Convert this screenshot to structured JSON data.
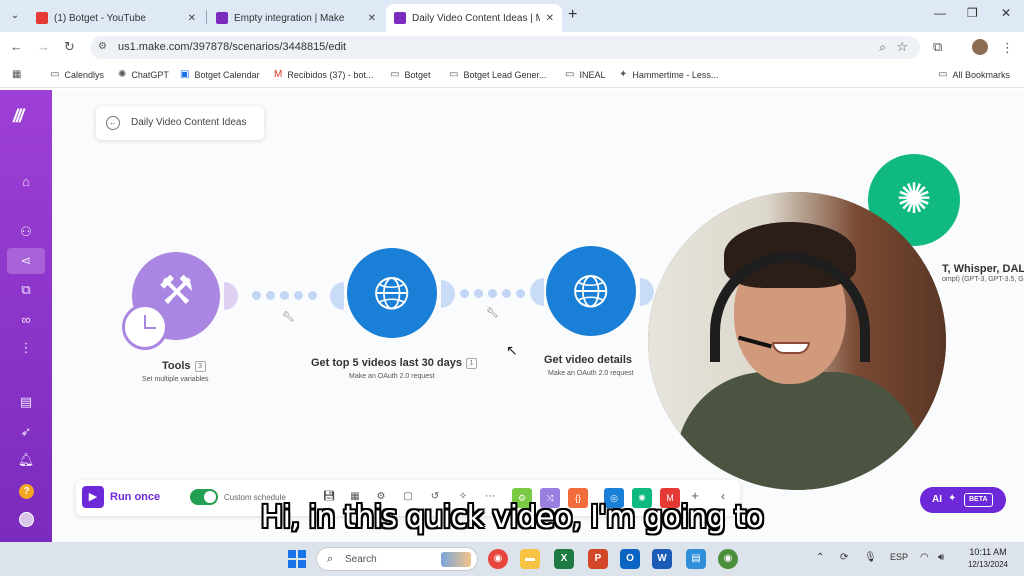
{
  "browser": {
    "tabs": [
      {
        "title": "(1) Botget - YouTube",
        "favicon_color": "#e53935"
      },
      {
        "title": "Empty integration | Make",
        "favicon_color": "#7b2cbf"
      },
      {
        "title": "Daily Video Content Ideas | Ma",
        "favicon_color": "#7b2cbf"
      }
    ],
    "new_tab": "+",
    "url": "us1.make.com/397878/scenarios/3448815/edit",
    "bookmarks": [
      {
        "label": "Calendlys",
        "icon": "folder-icon"
      },
      {
        "label": "ChatGPT",
        "icon": "chatgpt-icon"
      },
      {
        "label": "Botget Calendar",
        "icon": "calendar-icon"
      },
      {
        "label": "Recibidos (37) - bot...",
        "icon": "gmail-icon"
      },
      {
        "label": "Botget",
        "icon": "folder-icon"
      },
      {
        "label": "Botget Lead Gener...",
        "icon": "folder-icon"
      },
      {
        "label": "INEAL",
        "icon": "folder-icon"
      },
      {
        "label": "Hammertime - Less...",
        "icon": "hammer-icon"
      }
    ],
    "all_bookmarks": "All Bookmarks"
  },
  "make": {
    "scenario_name": "Daily Video Content Ideas",
    "modules": [
      {
        "name": "Tools",
        "subtitle": "Set multiple variables",
        "badge": "3"
      },
      {
        "name": "Get top 5 videos last 30 days",
        "subtitle": "Make an OAuth 2.0 request",
        "badge": "1"
      },
      {
        "name": "Get video details",
        "subtitle": "Make an OAuth 2.0 request",
        "badge": ""
      },
      {
        "name": "T, Whisper, DAL",
        "subtitle": "ompt) (GPT-3, GPT-3.5, G",
        "badge": ""
      }
    ],
    "toolbar": {
      "run_once": "Run once",
      "schedule": "Custom schedule"
    },
    "ai_button": {
      "label": "AI",
      "beta": "BETA"
    },
    "colors": {
      "brand": "#6d28d9",
      "tools": "#a986e2",
      "http": "#1a7fd6",
      "openai": "#10b981"
    }
  },
  "subtitle": "Hi, in this quick video, I'm going to",
  "taskbar": {
    "search": "Search",
    "language": "ESP",
    "time": "10:11 AM",
    "date": "12/13/2024"
  }
}
